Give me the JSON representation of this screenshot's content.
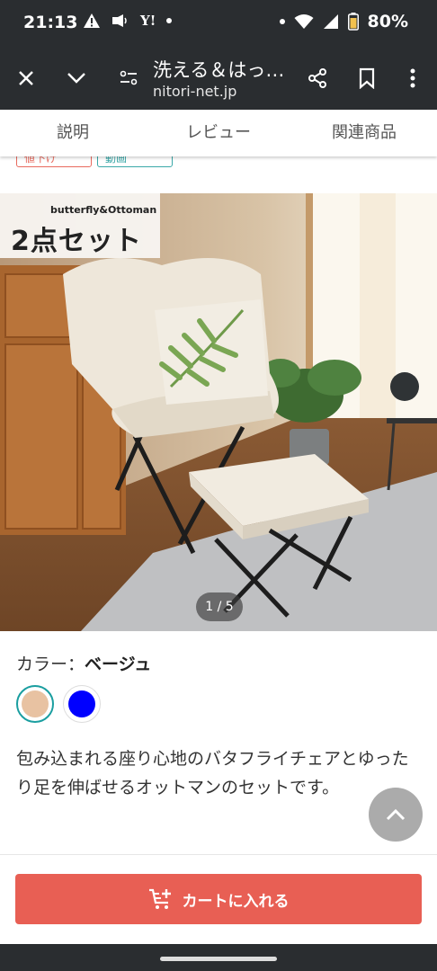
{
  "status_bar": {
    "time": "21:13",
    "yahoo": "Y!",
    "battery": "80%"
  },
  "browser": {
    "page_title": "洗える＆はっ…",
    "url": "nitori-net.jp"
  },
  "tabs": [
    {
      "label": "説明"
    },
    {
      "label": "レビュー"
    },
    {
      "label": "関連商品"
    }
  ],
  "tags": {
    "first": "値下げ",
    "second": "動画"
  },
  "image": {
    "badge_sub": "butterfly&Ottoman",
    "badge_main": "2点セット",
    "page_indicator": "1 / 5"
  },
  "color": {
    "label": "カラー：",
    "selected_name": "ベージュ",
    "swatches": [
      {
        "color": "#e8c2a2",
        "selected": true
      },
      {
        "color": "#0000ff",
        "selected": false
      }
    ]
  },
  "description": "包み込まれる座り心地のバタフライチェアとゆったり足を伸ばせるオットマンのセットです。",
  "cart": {
    "label": "カートに入れる"
  },
  "colors": {
    "accent": "#e85f54",
    "teal": "#1a9ea0",
    "dark": "#2a2d30"
  }
}
